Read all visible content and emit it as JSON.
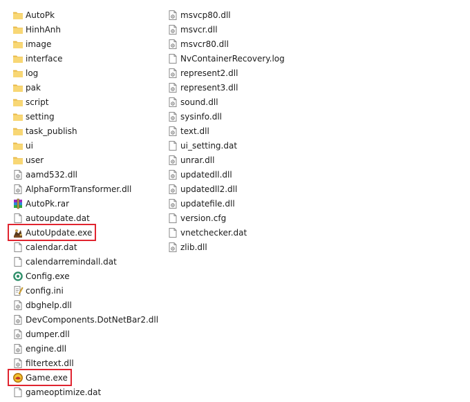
{
  "files": {
    "column1": [
      {
        "name": "AutoPk",
        "icon": "folder-icon"
      },
      {
        "name": "HinhAnh",
        "icon": "folder-icon"
      },
      {
        "name": "image",
        "icon": "folder-icon"
      },
      {
        "name": "interface",
        "icon": "folder-icon"
      },
      {
        "name": "log",
        "icon": "folder-icon"
      },
      {
        "name": "pak",
        "icon": "folder-icon"
      },
      {
        "name": "script",
        "icon": "folder-icon"
      },
      {
        "name": "setting",
        "icon": "folder-icon"
      },
      {
        "name": "task_publish",
        "icon": "folder-icon"
      },
      {
        "name": "ui",
        "icon": "folder-icon"
      },
      {
        "name": "user",
        "icon": "folder-icon"
      },
      {
        "name": "aamd532.dll",
        "icon": "dll-file-icon"
      },
      {
        "name": "AlphaFormTransformer.dll",
        "icon": "dll-file-icon"
      },
      {
        "name": "AutoPk.rar",
        "icon": "rar-archive-icon"
      },
      {
        "name": "autoupdate.dat",
        "icon": "blank-file-icon"
      },
      {
        "name": "AutoUpdate.exe",
        "icon": "autoupdate-app-icon",
        "highlighted": true
      },
      {
        "name": "calendar.dat",
        "icon": "blank-file-icon"
      },
      {
        "name": "calendarremindall.dat",
        "icon": "blank-file-icon"
      },
      {
        "name": "Config.exe",
        "icon": "config-app-icon"
      },
      {
        "name": "config.ini",
        "icon": "ini-file-icon"
      },
      {
        "name": "dbghelp.dll",
        "icon": "dll-file-icon"
      },
      {
        "name": "DevComponents.DotNetBar2.dll",
        "icon": "dll-file-icon"
      },
      {
        "name": "dumper.dll",
        "icon": "dll-file-icon"
      },
      {
        "name": "engine.dll",
        "icon": "dll-file-icon"
      },
      {
        "name": "filtertext.dll",
        "icon": "dll-file-icon"
      },
      {
        "name": "Game.exe",
        "icon": "game-app-icon",
        "highlighted": true
      },
      {
        "name": "gameoptimize.dat",
        "icon": "blank-file-icon"
      }
    ],
    "column2": [
      {
        "name": "msvcp80.dll",
        "icon": "dll-file-icon"
      },
      {
        "name": "msvcr.dll",
        "icon": "dll-file-icon"
      },
      {
        "name": "msvcr80.dll",
        "icon": "dll-file-icon"
      },
      {
        "name": "NvContainerRecovery.log",
        "icon": "blank-file-icon"
      },
      {
        "name": "represent2.dll",
        "icon": "dll-file-icon"
      },
      {
        "name": "represent3.dll",
        "icon": "dll-file-icon"
      },
      {
        "name": "sound.dll",
        "icon": "dll-file-icon"
      },
      {
        "name": "sysinfo.dll",
        "icon": "dll-file-icon"
      },
      {
        "name": "text.dll",
        "icon": "dll-file-icon"
      },
      {
        "name": "ui_setting.dat",
        "icon": "blank-file-icon"
      },
      {
        "name": "unrar.dll",
        "icon": "dll-file-icon"
      },
      {
        "name": "updatedll.dll",
        "icon": "dll-file-icon"
      },
      {
        "name": "updatedll2.dll",
        "icon": "dll-file-icon"
      },
      {
        "name": "updatefile.dll",
        "icon": "dll-file-icon"
      },
      {
        "name": "version.cfg",
        "icon": "blank-file-icon"
      },
      {
        "name": "vnetchecker.dat",
        "icon": "blank-file-icon"
      },
      {
        "name": "zlib.dll",
        "icon": "dll-file-icon"
      }
    ]
  },
  "colors": {
    "highlight_border": "#e0242f",
    "folder": "#f8d775",
    "text": "#1a1a1a"
  }
}
